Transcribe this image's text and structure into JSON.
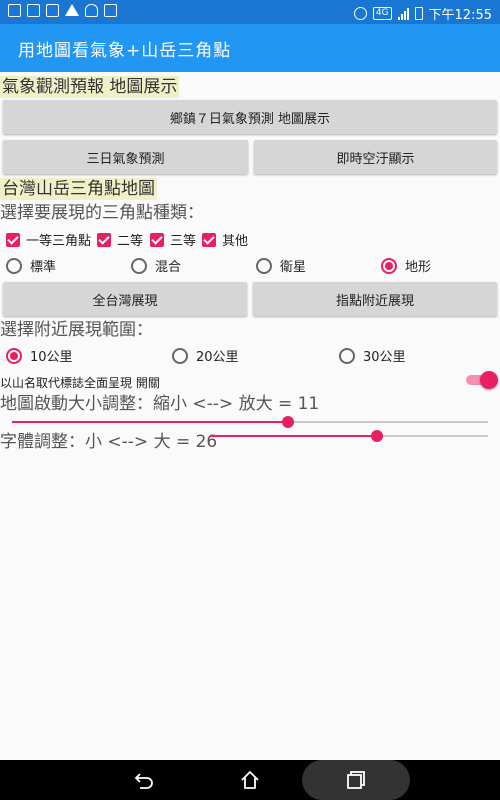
{
  "status_bar": {
    "badge": "4G",
    "time": "下午12:55"
  },
  "app_bar": {
    "title": "用地圖看氣象+山岳三角點"
  },
  "weather": {
    "heading": "氣象觀測預報 地圖展示",
    "btn_township": "鄉鎮７日氣象預測 地圖展示",
    "btn_three_day": "三日氣象預測",
    "btn_air": "即時空汙顯示"
  },
  "triangulation": {
    "heading": "台灣山岳三角點地圖",
    "type_label": "選擇要展現的三角點種類：",
    "checkboxes": [
      {
        "label": "一等三角點",
        "checked": true
      },
      {
        "label": "二等",
        "checked": true
      },
      {
        "label": "三等",
        "checked": true
      },
      {
        "label": "其他",
        "checked": true
      }
    ],
    "map_types": [
      {
        "label": "標準",
        "selected": false
      },
      {
        "label": "混合",
        "selected": false
      },
      {
        "label": "衛星",
        "selected": false
      },
      {
        "label": "地形",
        "selected": true
      }
    ],
    "btn_all_taiwan": "全台灣展現",
    "btn_nearby": "指點附近展現",
    "range_label": "選擇附近展現範圍：",
    "ranges": [
      {
        "label": "10公里",
        "selected": true
      },
      {
        "label": "20公里",
        "selected": false
      },
      {
        "label": "30公里",
        "selected": false
      }
    ],
    "switch_label": "以山名取代標誌全面呈現 開關",
    "switch_on": true,
    "zoom_label": "地圖啟動大小調整：縮小 <--> 放大 = 11",
    "zoom_level": 0.58,
    "font_label": "字體調整：小 <--> 大 = 26",
    "font_level": 0.6
  },
  "colors": {
    "status_bar": "#1976d2",
    "app_bar": "#2196f3",
    "accent": "#e91e63"
  },
  "nav_icons": [
    "back-icon",
    "home-icon",
    "recents-icon"
  ]
}
